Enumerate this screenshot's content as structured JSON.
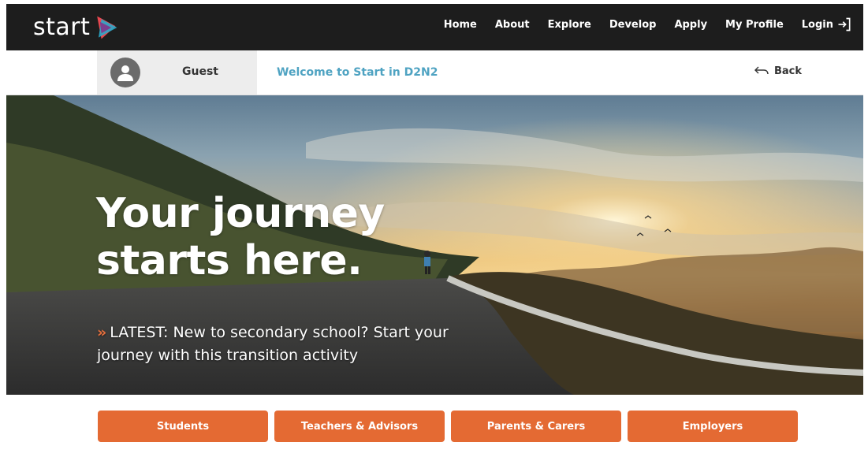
{
  "brand": {
    "logo_text": "start",
    "accent": "#e46a33",
    "welcome_color": "#4fa3c2"
  },
  "nav": {
    "items": [
      {
        "label": "Home"
      },
      {
        "label": "About"
      },
      {
        "label": "Explore"
      },
      {
        "label": "Develop"
      },
      {
        "label": "Apply"
      },
      {
        "label": "My Profile"
      }
    ],
    "login_label": "Login",
    "login_icon": "login-arrow-icon"
  },
  "userbar": {
    "user_name": "Guest",
    "avatar_icon": "user-avatar-icon",
    "welcome": "Welcome to Start in D2N2",
    "back_label": "Back",
    "back_icon": "back-arrow-icon"
  },
  "hero": {
    "headline_line1": "Your journey",
    "headline_line2": "starts here.",
    "latest_prefix": "»",
    "latest_text": "LATEST: New to secondary school? Start your journey with this transition activity"
  },
  "audiences": [
    {
      "label": "Students"
    },
    {
      "label": "Teachers & Advisors"
    },
    {
      "label": "Parents & Carers"
    },
    {
      "label": "Employers"
    }
  ]
}
